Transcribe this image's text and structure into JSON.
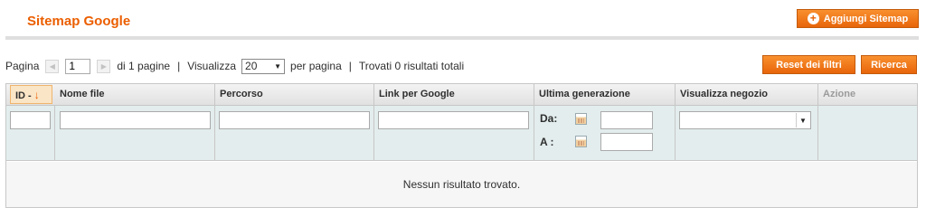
{
  "header": {
    "title": "Sitemap Google",
    "add_button_label": "Aggiungi Sitemap",
    "add_button_icon": "plus-circle-icon"
  },
  "pager": {
    "page_label": "Pagina",
    "current_page": "1",
    "of_pages": "di 1 pagine",
    "view_label": "Visualizza",
    "per_page_value": "20",
    "per_page_label": "per pagina",
    "found_text": "Trovati 0 risultati totali",
    "separator": "|"
  },
  "actions": {
    "reset_label": "Reset dei filtri",
    "search_label": "Ricerca"
  },
  "grid": {
    "columns": [
      {
        "label": "ID -",
        "sorted": true,
        "sort_direction": "desc"
      },
      {
        "label": "Nome file"
      },
      {
        "label": "Percorso"
      },
      {
        "label": "Link per Google"
      },
      {
        "label": "Ultima generazione"
      },
      {
        "label": "Visualizza negozio"
      },
      {
        "label": "Azione"
      }
    ],
    "sort_arrow": "↓",
    "filters": {
      "date_from_label": "Da:",
      "date_to_label": "A :"
    },
    "empty_message": "Nessun risultato trovato."
  },
  "colors": {
    "accent": "#eb5e00",
    "button": "#e8650a",
    "filter_row": "#e3eded",
    "sorted_header": "#fae5c6"
  }
}
